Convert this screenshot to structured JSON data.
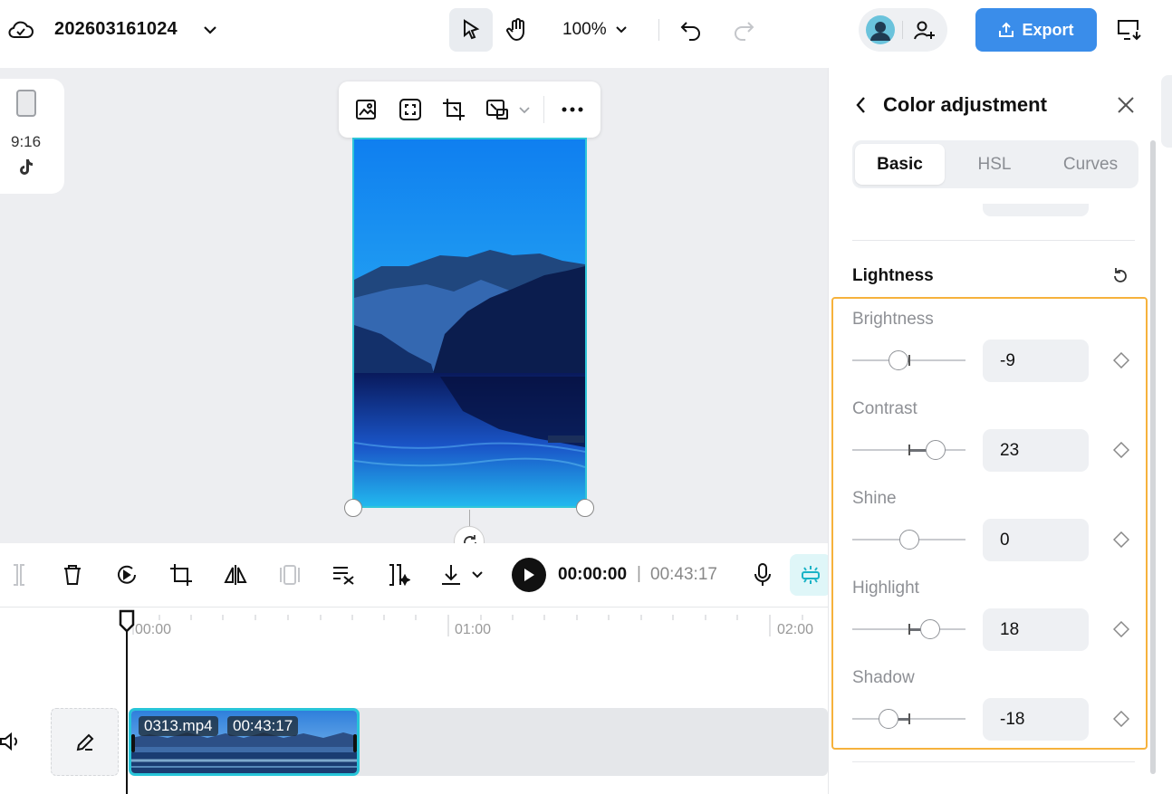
{
  "header": {
    "project_title": "202603161024",
    "zoom": "100%",
    "export_label": "Export"
  },
  "canvas": {
    "aspect_ratio": "9:16"
  },
  "timeline_toolbar": {
    "current_time": "00:00:00",
    "separator": "|",
    "total_time": "00:43:17"
  },
  "timeline": {
    "ruler": [
      "00:00",
      "01:00",
      "02:00"
    ],
    "clip": {
      "filename": "0313.mp4",
      "duration": "00:43:17"
    }
  },
  "panel": {
    "title": "Color adjustment",
    "tabs": [
      {
        "label": "Basic",
        "active": true
      },
      {
        "label": "HSL",
        "active": false
      },
      {
        "label": "Curves",
        "active": false
      }
    ],
    "section_title": "Lightness",
    "params": [
      {
        "label": "Brightness",
        "value": "-9"
      },
      {
        "label": "Contrast",
        "value": "23"
      },
      {
        "label": "Shine",
        "value": "0"
      },
      {
        "label": "Highlight",
        "value": "18"
      },
      {
        "label": "Shadow",
        "value": "-18"
      }
    ]
  },
  "colors": {
    "accent": "#3a8dea",
    "selection": "#27c5d9",
    "highlight_box": "#f6b23c"
  }
}
